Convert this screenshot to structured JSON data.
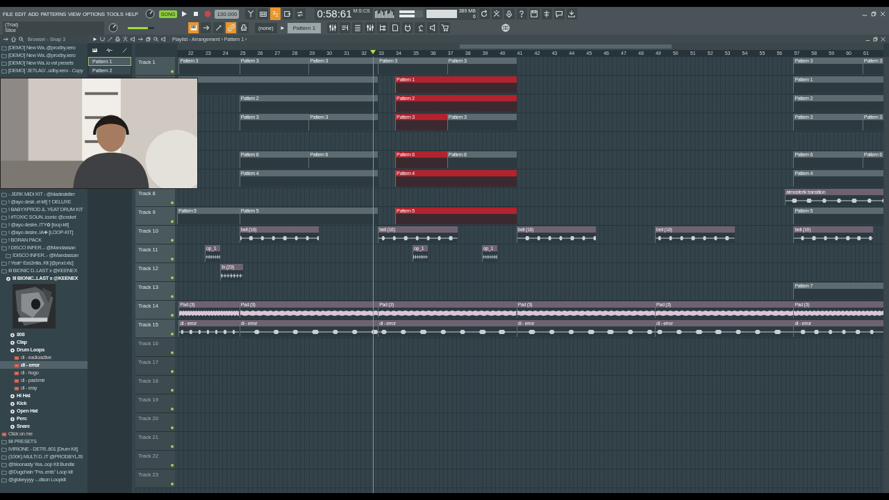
{
  "menu": [
    "FILE",
    "EDIT",
    "ADD",
    "PATTERNS",
    "VIEW",
    "OPTIONS",
    "TOOLS",
    "HELP"
  ],
  "transport": {
    "mode": "SONG",
    "song_mode": true,
    "tempo": "130.000",
    "step": "3$_{2}$",
    "step_on": true,
    "time": "0:58:61",
    "time_unit": "M:S:CS",
    "memory": "389 MB",
    "cpu": "6"
  },
  "hint": {
    "line_1": "(Trial)",
    "line_2": "Slice"
  },
  "master_volume": {
    "level": 0.75
  },
  "tools": [
    {
      "kind": "piano",
      "on": true
    },
    {
      "kind": "arrow",
      "on": false
    },
    {
      "kind": "pencil",
      "on": false
    },
    {
      "kind": "link",
      "on": true
    },
    {
      "kind": "stamp",
      "on": false
    }
  ],
  "pattern_selector": {
    "channel": "(none)",
    "pattern": "Pattern 1"
  },
  "browser": {
    "title": "Browser - Snap 3",
    "sections": [
      {
        "items": [
          {
            "kind": "folder",
            "label": "[DEMO] New Wa..@prodby.xero",
            "selected": false
          },
          {
            "kind": "folder",
            "label": "[DEMO] New Wa..@prodby.xero",
            "selected": false
          },
          {
            "kind": "folder",
            "label": "[DEMO] New Wa..lo vst presets",
            "selected": false
          },
          {
            "kind": "folder",
            "label": "[DEMO] 'JETLAG'..odby.xero - Copy",
            "selected": false
          }
        ]
      },
      {
        "items": [
          {
            "kind": "folder",
            "label": "- JERK MIDI KIT - @bladesteller",
            "selected": false
          },
          {
            "kind": "folder",
            "label": "!  @ayo desir..et kit] † DELUXE",
            "selected": false
          },
          {
            "kind": "folder",
            "label": "!  BABYXPROD &..YEAT DRUM KIT",
            "selected": false
          },
          {
            "kind": "folder",
            "label": "!  #TOXIC SOUN..iconic @cxsket",
            "selected": false
          },
          {
            "kind": "folder",
            "label": "! @ayo desire..ITY✿ [loop-kit]",
            "selected": false
          },
          {
            "kind": "folder",
            "label": "! @ayo desire..IA✚ [LOOP-KIT]",
            "selected": false
          },
          {
            "kind": "folder",
            "label": "! BORAN PACK",
            "selected": false
          },
          {
            "kind": "folder",
            "label": "! DISCO INFER..- @Mandassan",
            "selected": false,
            "children": [
              {
                "kind": "folder",
                "label": "!DISCO INFER..- @Mandassan",
                "selected": false
              }
            ]
          },
          {
            "kind": "folder",
            "label": "! Yeat^ Ess3ntia..Kit [@prod.xtc]",
            "selected": false
          },
          {
            "kind": "folder",
            "label": "III BIONIC D..LAST x @KEENEX",
            "selected": false,
            "children": [
              {
                "kind": "pack",
                "label": "III BIONIC..LAST x @KEENEX",
                "selected": false,
                "children": [
                  {
                    "kind": "picture"
                  },
                  {
                    "kind": "pack",
                    "label": "808",
                    "selected": false
                  },
                  {
                    "kind": "pack",
                    "label": "Clap",
                    "selected": false
                  },
                  {
                    "kind": "pack",
                    "label": "Drum Loops",
                    "selected": false,
                    "children": [
                      {
                        "kind": "sample",
                        "label": "dl - eadioactive",
                        "selected": false
                      },
                      {
                        "kind": "sample",
                        "label": "dl - error",
                        "selected": true
                      },
                      {
                        "kind": "sample",
                        "label": "dl - hugo",
                        "selected": false
                      },
                      {
                        "kind": "sample",
                        "label": "dl - pashmir",
                        "selected": false
                      },
                      {
                        "kind": "sample",
                        "label": "dl - xray",
                        "selected": false
                      }
                    ]
                  },
                  {
                    "kind": "pack",
                    "label": "Hi Hat",
                    "selected": false
                  },
                  {
                    "kind": "pack",
                    "label": "Kick",
                    "selected": false
                  },
                  {
                    "kind": "pack",
                    "label": "Open Hat",
                    "selected": false
                  },
                  {
                    "kind": "pack",
                    "label": "Perc",
                    "selected": false
                  },
                  {
                    "kind": "pack",
                    "label": "Snare",
                    "selected": false
                  }
                ]
              }
            ]
          },
          {
            "kind": "sample",
            "label": "Click on me",
            "selected": false
          },
          {
            "kind": "folder",
            "label": "IIII PRESETS",
            "selected": false
          },
          {
            "kind": "folder",
            "label": "IVIRIONE - DETR..601 [Drum Kit]",
            "selected": false
          },
          {
            "kind": "folder",
            "label": "(100K) MULTI D..IT @PRODBYLJS",
            "selected": false
          },
          {
            "kind": "folder",
            "label": "@bloonasty Yea..oop Kit Bundle",
            "selected": false
          },
          {
            "kind": "folder",
            "label": "@Dugchain \"Fra..ents\" Loop kit",
            "selected": false
          },
          {
            "kind": "folder",
            "label": "@glokeyyyy -..dison Loopkit",
            "selected": false
          }
        ]
      }
    ]
  },
  "picker": {
    "patterns": [
      {
        "label": "Pattern 1",
        "selected": true
      },
      {
        "label": "Pattern 2",
        "selected": false
      }
    ]
  },
  "playlist": {
    "title": "Playlist - Arrangement › Pattern 1 ›",
    "ruler": [
      "22",
      "23",
      "24",
      "25",
      "26",
      "27",
      "28",
      "29",
      "30",
      "31",
      "32",
      "33",
      "34",
      "35",
      "36",
      "37",
      "38",
      "39",
      "40",
      "41",
      "42",
      "43",
      "44",
      "45",
      "46",
      "47",
      "48",
      "49",
      "50",
      "51",
      "52",
      "53",
      "54",
      "55",
      "56",
      "57",
      "58",
      "59",
      "60",
      "61"
    ],
    "tracks": [
      {
        "name": "Track 1",
        "empty": false,
        "clips": [
          {
            "kind": "pattern",
            "label": "Pattern 3",
            "selected": false
          },
          {
            "kind": "pattern",
            "label": "Pattern 3",
            "selected": false
          },
          {
            "kind": "pattern",
            "label": "Pattern 3",
            "selected": false
          },
          {
            "kind": "pattern",
            "label": "Pattern 3",
            "selected": false
          },
          {
            "kind": "pattern",
            "label": "Pattern 3",
            "selected": false
          },
          {
            "kind": "pattern",
            "label": "Pattern 3",
            "selected": false
          },
          {
            "kind": "pattern",
            "label": "Pattern 3",
            "selected": false
          }
        ]
      },
      {
        "clips": [
          {
            "kind": "pattern",
            "selected": false
          },
          {
            "kind": "pattern",
            "label": "Pattern 1",
            "selected": true
          },
          {
            "kind": "pattern",
            "label": "Pattern 1",
            "selected": false
          }
        ]
      },
      {
        "clips": [
          {
            "kind": "pattern",
            "label": "Pattern 2",
            "selected": false
          },
          {
            "kind": "pattern",
            "label": "Pattern 2",
            "selected": true
          },
          {
            "kind": "pattern",
            "label": "Pattern 2",
            "selected": false
          }
        ]
      },
      {
        "clips": [
          {
            "kind": "pattern",
            "label": "Pattern 3",
            "selected": false
          },
          {
            "kind": "pattern",
            "label": "Pattern 3",
            "selected": false
          },
          {
            "kind": "pattern",
            "label": "Pattern 3",
            "selected": true
          },
          {
            "kind": "pattern",
            "label": "Pattern 3",
            "selected": false
          },
          {
            "kind": "pattern",
            "label": "Pattern 3",
            "selected": false
          },
          {
            "kind": "pattern",
            "label": "Pattern 3",
            "selected": false
          }
        ]
      },
      {
        "clips": [
          {
            "kind": "pattern",
            "label": "Pattern 6",
            "selected": false
          },
          {
            "kind": "pattern",
            "label": "Pattern 6",
            "selected": false
          },
          {
            "kind": "pattern",
            "label": "Pattern 6",
            "selected": true
          },
          {
            "kind": "pattern",
            "label": "Pattern 6",
            "selected": false
          },
          {
            "kind": "pattern",
            "label": "Pattern 6",
            "selected": false
          },
          {
            "kind": "pattern",
            "label": "Pattern 6",
            "selected": false
          }
        ]
      },
      {
        "clips": [
          {
            "kind": "pattern",
            "label": "Pattern 4",
            "selected": false
          },
          {
            "kind": "pattern",
            "label": "Pattern 4",
            "selected": true
          },
          {
            "kind": "pattern",
            "label": "Pattern 4",
            "selected": false
          }
        ]
      },
      {
        "name": "Track 8",
        "empty": false,
        "clips": [
          {
            "kind": "audio",
            "label": "atmosferik transition",
            "selected": false
          }
        ]
      },
      {
        "name": "Track 9",
        "empty": false,
        "clips": [
          {
            "kind": "pattern",
            "label": "Pattern 5",
            "selected": false
          },
          {
            "kind": "pattern",
            "label": "Pattern 5",
            "selected": false
          },
          {
            "kind": "pattern",
            "label": "Pattern 5",
            "selected": true
          },
          {
            "kind": "pattern",
            "label": "Pattern 5",
            "selected": false
          }
        ]
      },
      {
        "name": "Track 10",
        "empty": false,
        "clips": [
          {
            "kind": "audio",
            "label": "bell (16)",
            "selected": false
          },
          {
            "kind": "audio",
            "label": "bell (16)",
            "selected": false
          },
          {
            "kind": "audio",
            "label": "bell (16)",
            "selected": false
          },
          {
            "kind": "audio",
            "label": "bell (16)",
            "selected": false
          },
          {
            "kind": "audio",
            "label": "bell (16)",
            "selected": false
          }
        ]
      },
      {
        "name": "Track 11",
        "empty": false,
        "clips": [
          {
            "kind": "audio",
            "label": "op_1",
            "selected": false
          },
          {
            "kind": "audio",
            "label": "op_1",
            "selected": false
          },
          {
            "kind": "audio",
            "label": "op_1",
            "selected": false
          }
        ]
      },
      {
        "name": "Track 12",
        "empty": false,
        "clips": [
          {
            "kind": "audio",
            "label": "fx (29)",
            "selected": false
          }
        ]
      },
      {
        "name": "Track 13",
        "empty": false,
        "clips": [
          {
            "kind": "pattern",
            "label": "Pattern 7",
            "selected": false
          }
        ]
      },
      {
        "name": "Track 14",
        "empty": false,
        "clips": [
          {
            "kind": "audio",
            "label": "Pad (3)",
            "selected": false
          },
          {
            "kind": "audio",
            "label": "Pad (3)",
            "selected": false
          },
          {
            "kind": "audio",
            "label": "Pad (3)",
            "selected": false
          },
          {
            "kind": "audio",
            "label": "Pad (3)",
            "selected": false
          },
          {
            "kind": "audio",
            "label": "Pad (3)",
            "selected": false
          },
          {
            "kind": "audio",
            "label": "Pad (3)",
            "selected": false
          }
        ]
      },
      {
        "name": "Track 15",
        "empty": false,
        "clips": [
          {
            "kind": "audio",
            "label": "dl - error",
            "selected": false
          },
          {
            "kind": "audio",
            "label": "dl - error",
            "selected": false
          },
          {
            "kind": "audio",
            "label": "dl - error",
            "selected": false
          },
          {
            "kind": "audio",
            "label": "dl - error",
            "selected": false
          },
          {
            "kind": "audio",
            "label": "dl - error",
            "selected": false
          },
          {
            "kind": "audio",
            "label": "dl - error",
            "selected": false
          }
        ]
      },
      {
        "name": "Track 16",
        "empty": true
      },
      {
        "name": "Track 17",
        "empty": true
      },
      {
        "name": "Track 18",
        "empty": true
      },
      {
        "name": "Track 19",
        "empty": true
      },
      {
        "name": "Track 20",
        "empty": true
      },
      {
        "name": "Track 21",
        "empty": true
      },
      {
        "name": "Track 22",
        "empty": true
      },
      {
        "name": "Track 23",
        "empty": true
      }
    ]
  },
  "webcam": {
    "kind": "picture"
  }
}
